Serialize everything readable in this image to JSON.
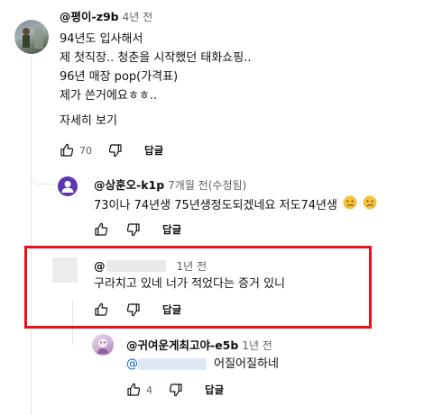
{
  "comments": [
    {
      "author": "@평이-z9b",
      "time": "4년 전",
      "lines": [
        "94년도 입사해서",
        "제 첫직장.. 청춘을 시작했던 태화쇼핑..",
        "96년 매장 pop(가격표)",
        "제가 쓴거에요ㅎㅎ.."
      ],
      "more_label": "자세히 보기",
      "likes": "70",
      "reply_label": "답글"
    },
    {
      "author": "@상훈오-k1p",
      "time": "7개월 전(수정됨)",
      "text": "73이나 74년생 75년생정도되겠네요 저도74년생",
      "reply_label": "답글"
    },
    {
      "author": "@",
      "time": "1년 전",
      "text": "구라치고 있네 너가 적었다는 증거 있니",
      "reply_label": "답글"
    },
    {
      "author": "@귀여운게최고야-e5b",
      "time": "1년 전",
      "mention": "@",
      "text": "어질어질하네",
      "likes": "4",
      "reply_label": "답글"
    }
  ],
  "colors": {
    "highlight_border": "#e8131a",
    "mention": "#065fd4",
    "avatar2": "#5e35b1"
  },
  "icons": [
    "like-icon",
    "dislike-icon",
    "sad-face-emoji"
  ]
}
